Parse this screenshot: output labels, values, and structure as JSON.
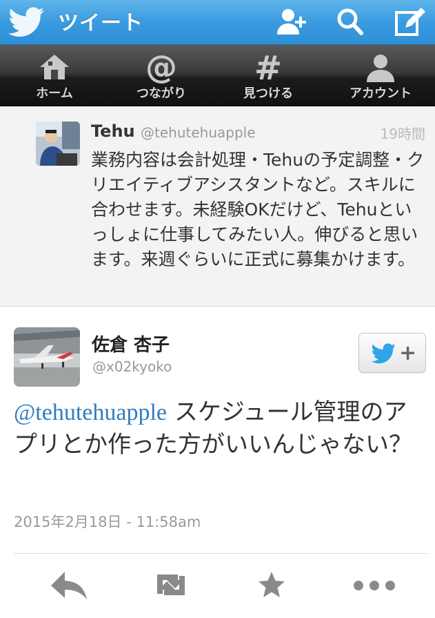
{
  "header": {
    "title": "ツイート",
    "colors": {
      "accent": "#3a9be0",
      "tab_bg": "#1c1c1c",
      "link": "#2f7cc1"
    }
  },
  "tabs": [
    {
      "label": "ホーム",
      "icon": "home-icon"
    },
    {
      "label": "つながり",
      "icon": "at-icon"
    },
    {
      "label": "見つける",
      "icon": "hash-icon"
    },
    {
      "label": "アカウント",
      "icon": "person-icon"
    }
  ],
  "reply_to": {
    "name": "Tehu",
    "handle": "@tehutehuapple",
    "time": "19時間",
    "text": "業務内容は会計処理・Tehuの予定調整・クリエイティブアシスタントなど。スキルに合わせます。未経験OKだけど、Tehuといっしょに仕事してみたい人。伸びると思います。来週ぐらいに正式に募集かけます。"
  },
  "tweet": {
    "name": "佐倉 杏子",
    "handle": "@x02kyoko",
    "mention": "@tehutehuapple",
    "text": " スケジュール管理のアプリとか作った方がいいんじゃない？",
    "date": "2015年2月18日 - 11:58am",
    "follow_plus": "+"
  },
  "actions": [
    {
      "icon": "reply-icon"
    },
    {
      "icon": "retweet-icon"
    },
    {
      "icon": "favorite-icon"
    },
    {
      "icon": "more-icon"
    }
  ]
}
